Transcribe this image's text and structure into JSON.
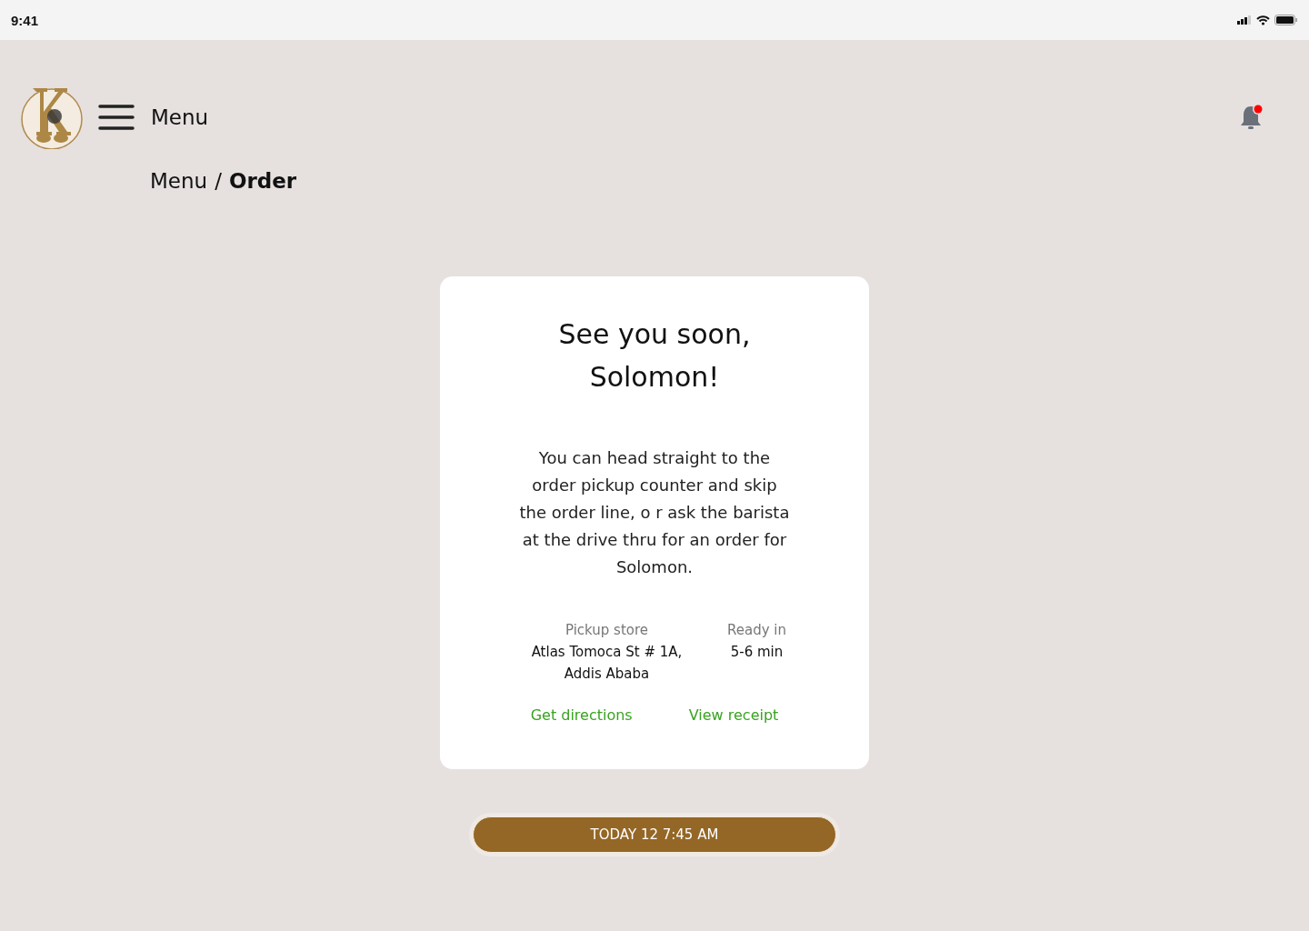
{
  "status_bar": {
    "time": "9:41"
  },
  "header": {
    "menu_label": "Menu",
    "notifications": {
      "unread": true
    }
  },
  "breadcrumb": {
    "parent": "Menu",
    "separator": "/",
    "current": "Order"
  },
  "card": {
    "title": "See you soon, Solomon!",
    "message": "You can head straight to the order pickup counter and skip the order line, o r ask the barista at the drive thru for an order for Solomon.",
    "details": [
      {
        "label": "Pickup store",
        "value": "Atlas Tomoca St # 1A, Addis Ababa"
      },
      {
        "label": "Ready in",
        "value": "5-6 min"
      }
    ],
    "links": [
      "Get directions",
      "View receipt"
    ]
  },
  "pickup_button": {
    "label": "TODAY 12 7:45 AM"
  }
}
